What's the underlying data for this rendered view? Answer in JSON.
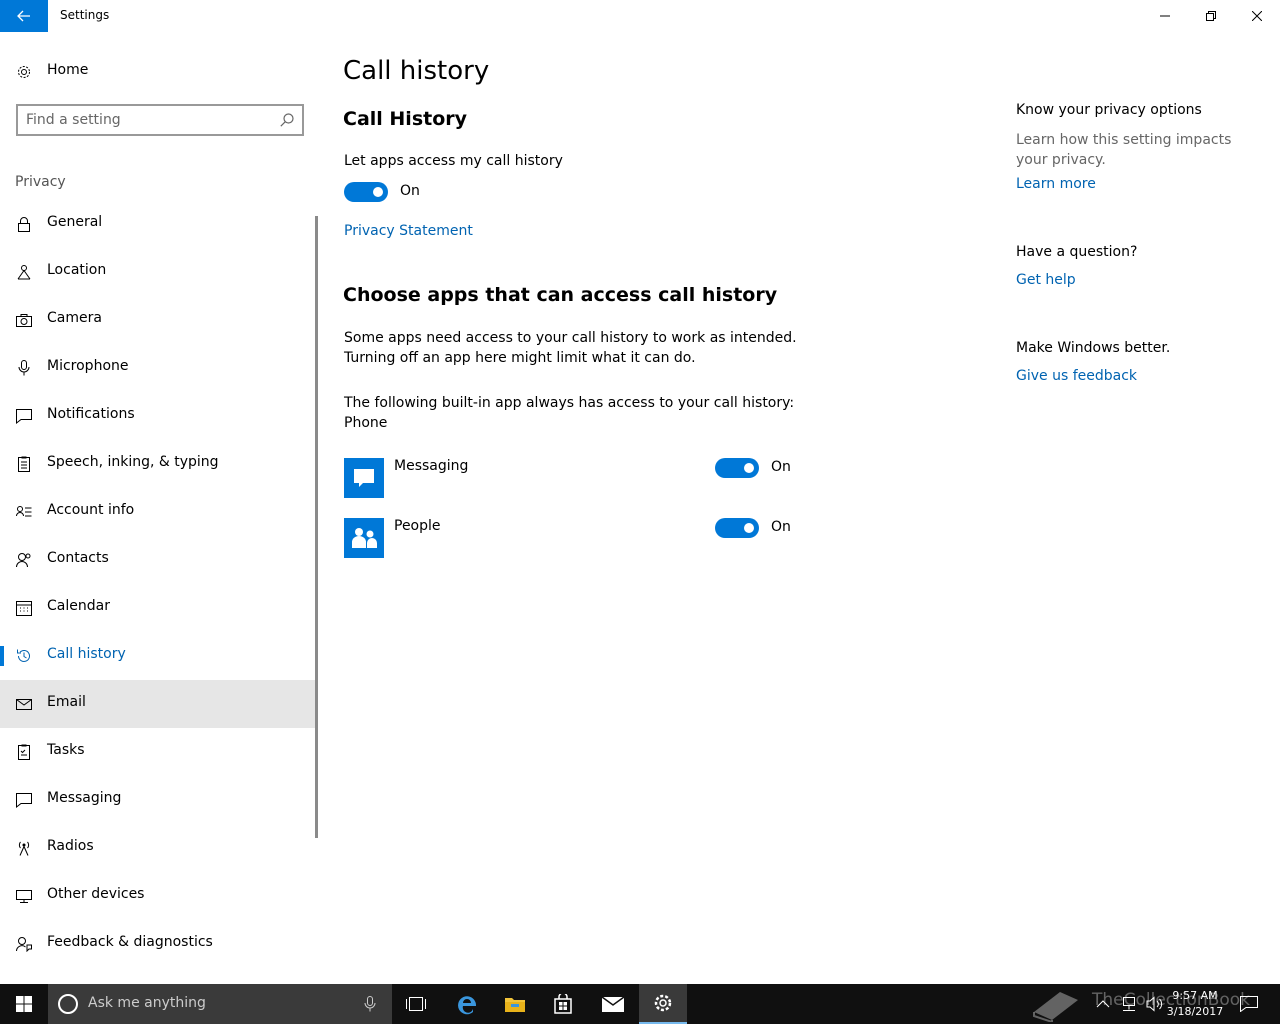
{
  "window": {
    "title": "Settings",
    "accent": "#0078d7",
    "link_color": "#0063b1"
  },
  "sidebar": {
    "home_label": "Home",
    "search_placeholder": "Find a setting",
    "section": "Privacy",
    "items": [
      {
        "label": "General",
        "icon": "lock-icon"
      },
      {
        "label": "Location",
        "icon": "location-icon"
      },
      {
        "label": "Camera",
        "icon": "camera-icon"
      },
      {
        "label": "Microphone",
        "icon": "microphone-icon"
      },
      {
        "label": "Notifications",
        "icon": "notifications-icon"
      },
      {
        "label": "Speech, inking, & typing",
        "icon": "speech-icon"
      },
      {
        "label": "Account info",
        "icon": "account-info-icon"
      },
      {
        "label": "Contacts",
        "icon": "contacts-icon"
      },
      {
        "label": "Calendar",
        "icon": "calendar-icon"
      },
      {
        "label": "Call history",
        "icon": "history-icon",
        "state": "active"
      },
      {
        "label": "Email",
        "icon": "mail-icon",
        "state": "hover"
      },
      {
        "label": "Tasks",
        "icon": "tasks-icon"
      },
      {
        "label": "Messaging",
        "icon": "message-icon"
      },
      {
        "label": "Radios",
        "icon": "radio-tower-icon"
      },
      {
        "label": "Other devices",
        "icon": "devices-icon"
      },
      {
        "label": "Feedback & diagnostics",
        "icon": "feedback-icon"
      }
    ]
  },
  "main": {
    "page_title": "Call history",
    "section1_title": "Call History",
    "toggle_label": "Let apps access my call history",
    "toggle_state": "On",
    "privacy_link": "Privacy Statement",
    "section2_title": "Choose apps that can access call history",
    "desc_line1": "Some apps need access to your call history to work as intended.",
    "desc_line2": "Turning off an app here might limit what it can do.",
    "builtin_line1": "The following built-in app always has access to your call history:",
    "builtin_line2": "Phone",
    "apps": [
      {
        "name": "Messaging",
        "state": "On",
        "icon": "messaging-app-icon"
      },
      {
        "name": "People",
        "state": "On",
        "icon": "people-app-icon"
      }
    ]
  },
  "right_panel": {
    "privacy_title": "Know your privacy options",
    "privacy_text": "Learn how this setting impacts your privacy.",
    "learn_more": "Learn more",
    "question_title": "Have a question?",
    "get_help": "Get help",
    "better_title": "Make Windows better.",
    "feedback_link": "Give us feedback"
  },
  "taskbar": {
    "search_text": "Ask me anything",
    "time": "9:57 AM",
    "date": "3/18/2017",
    "watermark": "TheCollectionBook"
  }
}
